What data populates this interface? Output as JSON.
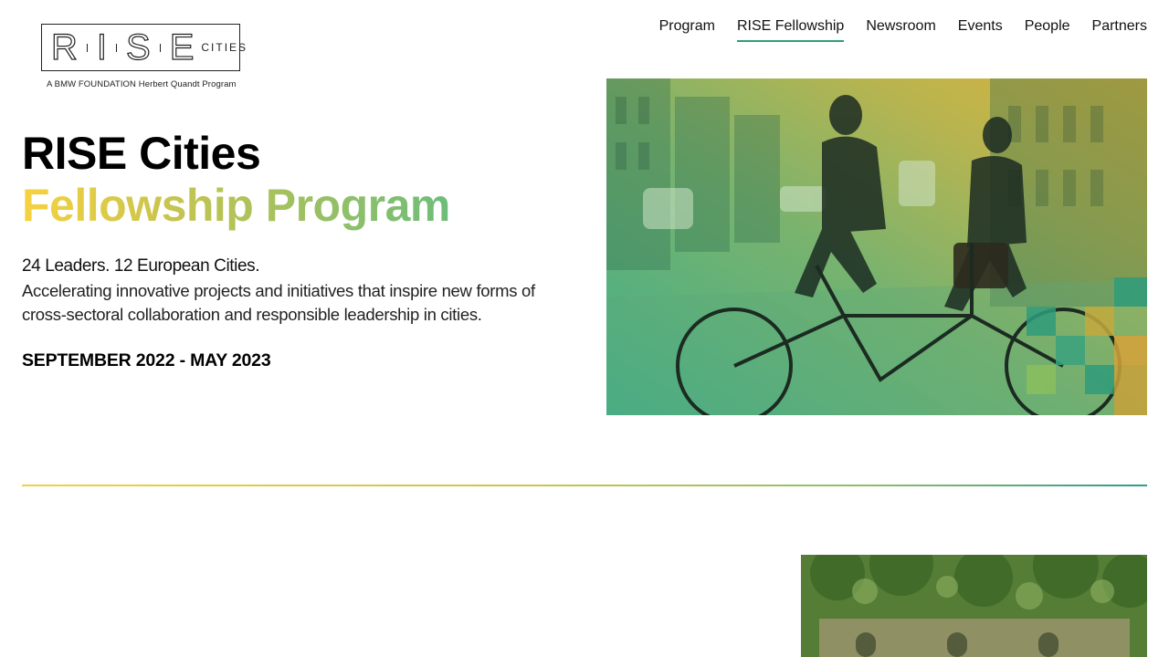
{
  "logo": {
    "letters": [
      "R",
      "I",
      "S",
      "E"
    ],
    "cities": "CITIES",
    "subtitle": "A BMW FOUNDATION Herbert Quandt Program"
  },
  "nav": {
    "items": [
      {
        "label": "Program",
        "active": false
      },
      {
        "label": "RISE Fellowship",
        "active": true
      },
      {
        "label": "Newsroom",
        "active": false
      },
      {
        "label": "Events",
        "active": false
      },
      {
        "label": "People",
        "active": false
      },
      {
        "label": "Partners",
        "active": false
      }
    ],
    "active_underline_color": "#2f9c7b"
  },
  "hero": {
    "title_line1": "RISE Cities",
    "title_line2": "Fellowship Program",
    "tagline": "24 Leaders. 12 European Cities.",
    "description": "Accelerating innovative projects and initiatives that inspire new forms of cross-sectoral collaboration and responsible leadership in cities.",
    "dates": "SEPTEMBER 2022 - MAY 2023"
  },
  "colors": {
    "gradient_start": "#f6d23f",
    "gradient_end": "#2f9c8c"
  }
}
